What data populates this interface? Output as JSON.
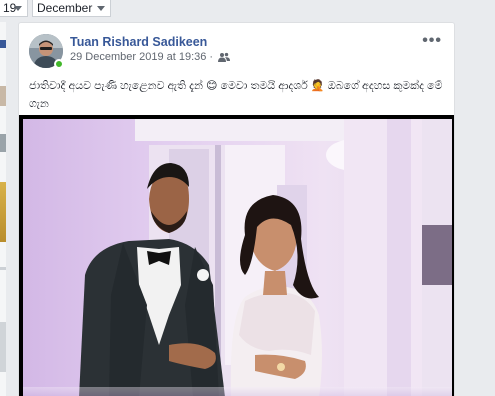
{
  "filters": {
    "year_value": "19",
    "month_value": "December"
  },
  "post": {
    "author": "Tuan Rishard Sadikeen",
    "timestamp": "29 December 2019 at 19:36",
    "separator": "·",
    "audience_icon": "friends-icon",
    "more_label": "•••",
    "text": "ජාතිවාදී අයව පැණි හැළෙනව ඇති දැන් 😊 මෙවා තමයි ආදර්ශ 🤦 ඔබගේ අදහස කුමක්ද මේ ගැන",
    "image_description_icon": "wedding-photo"
  },
  "colors": {
    "link": "#385898",
    "online": "#42b72a",
    "page_bg": "#e9ebee"
  }
}
